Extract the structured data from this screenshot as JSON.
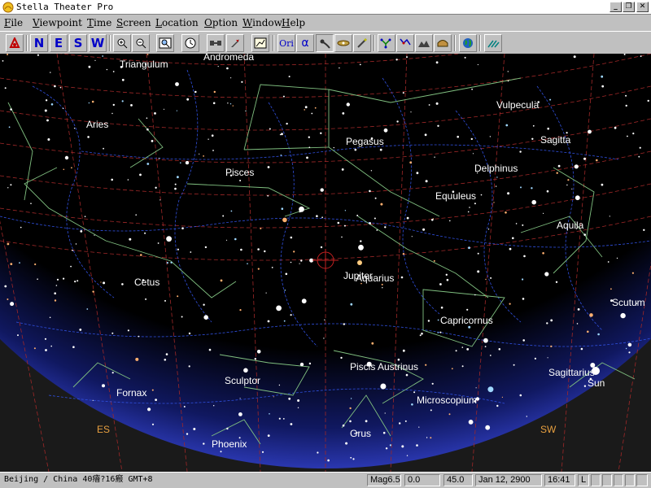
{
  "window": {
    "title": "Stella Theater Pro",
    "minimize_glyph": "_",
    "maximize_glyph": "❐",
    "close_glyph": "✕"
  },
  "menu": [
    {
      "label": "File",
      "key": "F"
    },
    {
      "label": "Viewpoint",
      "key": "V"
    },
    {
      "label": "Time",
      "key": "T"
    },
    {
      "label": "Screen",
      "key": "S"
    },
    {
      "label": "Location",
      "key": "L"
    },
    {
      "label": "Option",
      "key": "O"
    },
    {
      "label": "Window",
      "key": "W"
    },
    {
      "label": "Help",
      "key": "H"
    }
  ],
  "toolbar": {
    "dir_north": "N",
    "dir_east": "E",
    "dir_south": "S",
    "dir_west": "W",
    "ori_label": "Ori",
    "alpha_label": "α"
  },
  "sky": {
    "constellations": [
      "Triangulum",
      "Andromeda",
      "Aries",
      "Pegasus",
      "Vulpecula",
      "Sagitta",
      "Pisces",
      "Delphinus",
      "Equuleus",
      "Aquila",
      "Cetus",
      "Aquarius",
      "Scutum",
      "Capricornus",
      "Sculptor",
      "Piscis Austrinus",
      "Fornax",
      "Microscopium",
      "Phoenix",
      "Grus"
    ],
    "planets": [
      "Jupiter",
      "Sagittarius",
      "Sun"
    ],
    "horizon_labels": [
      "ES",
      "SW"
    ]
  },
  "status": {
    "location": "Beijing / China  40瘖?16瘢  GMT+8",
    "magnitude": "Mag6.5",
    "field1": "0.0",
    "field2": "45.0",
    "date": "Jan 12, 2900",
    "time": "16:41",
    "mode": "L"
  },
  "colors": {
    "sky_bg": "#000000",
    "ground": "#1a1a1a",
    "horizon_glow": "#2a3ad0",
    "grid_red": "#a02828",
    "boundary_blue": "#3050e0",
    "constellation_line": "#80c080",
    "label_white": "#ffffff",
    "horizon_label": "#e8a040"
  }
}
